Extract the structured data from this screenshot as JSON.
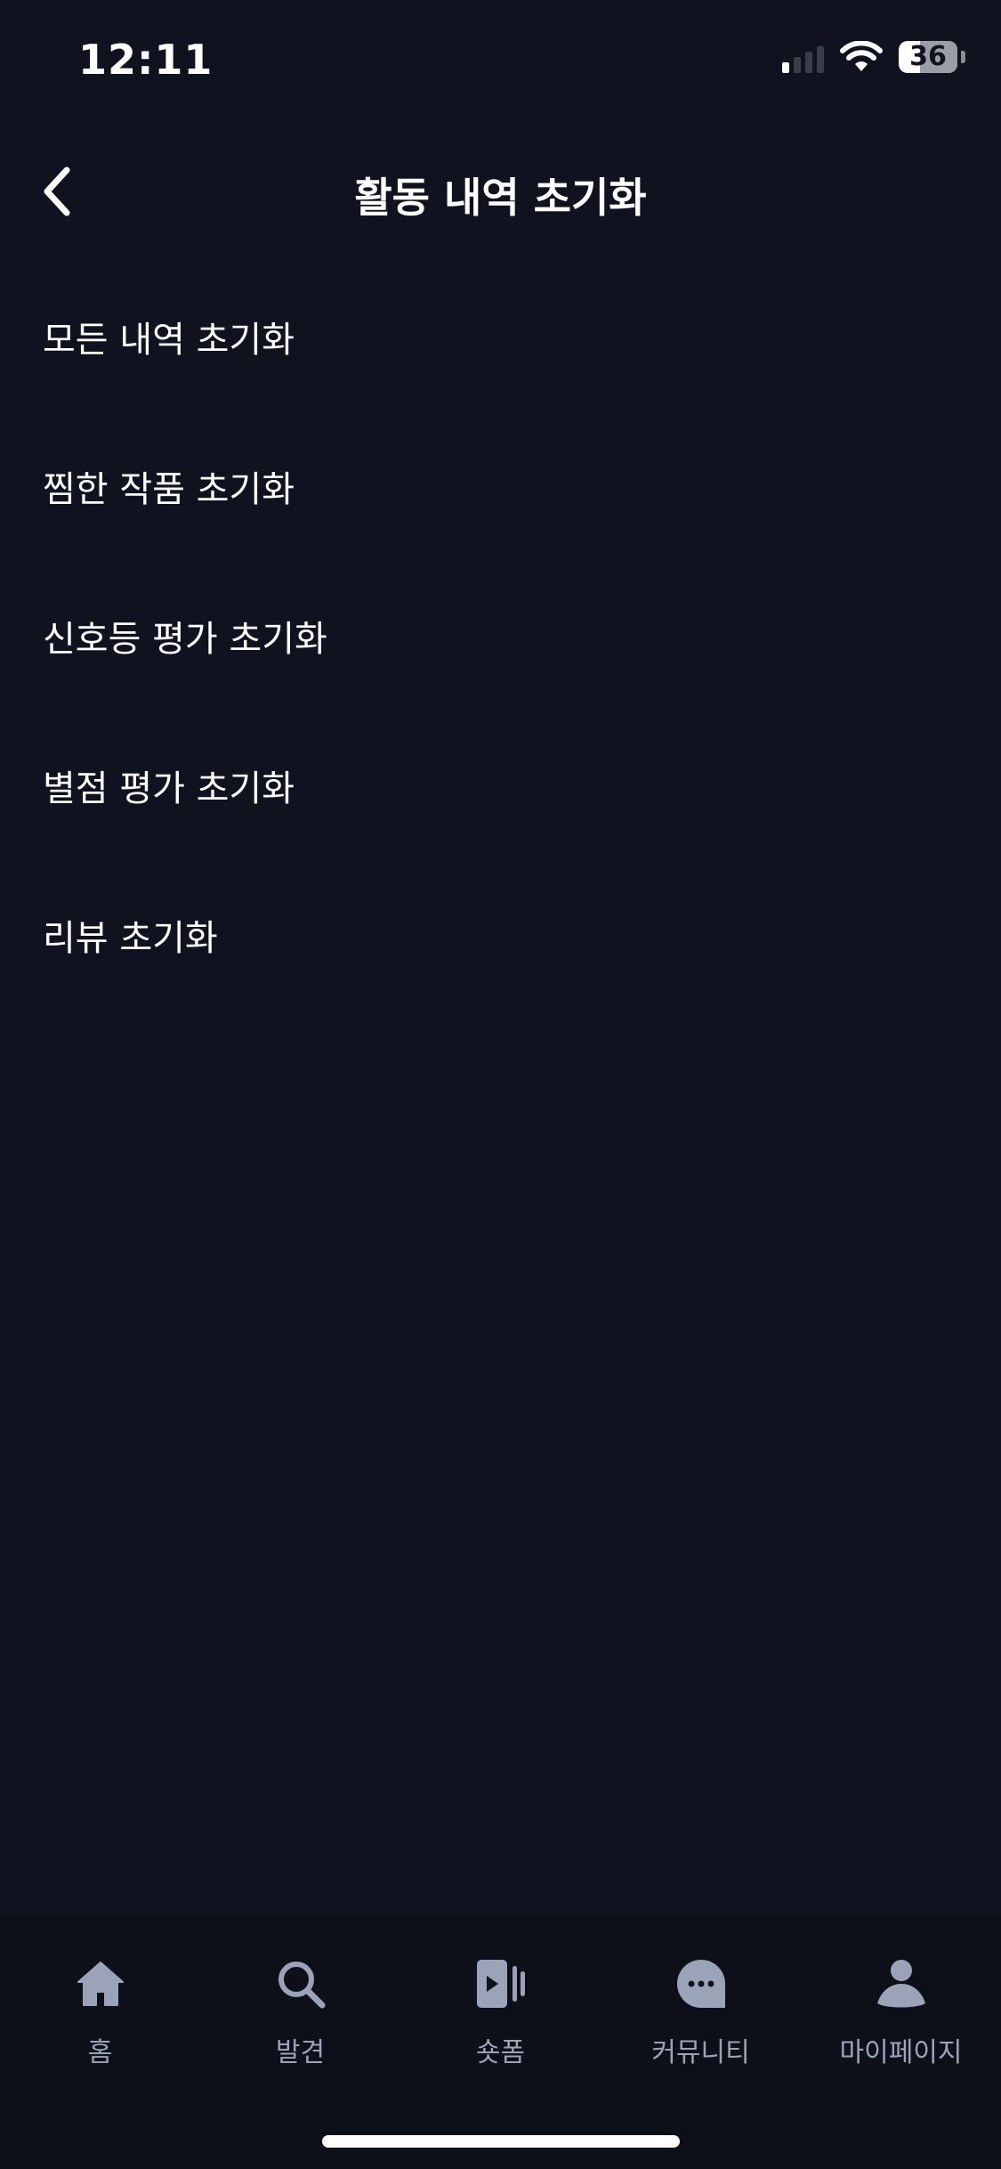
{
  "status_bar": {
    "time": "12:11",
    "battery": "36",
    "battery_level_percent": 36
  },
  "header": {
    "title": "활동 내역 초기화"
  },
  "menu": {
    "items": [
      {
        "label": "모든 내역 초기화"
      },
      {
        "label": "찜한 작품 초기화"
      },
      {
        "label": "신호등 평가 초기화"
      },
      {
        "label": "별점 평가 초기화"
      },
      {
        "label": "리뷰 초기화"
      }
    ]
  },
  "tab_bar": {
    "tabs": [
      {
        "label": "홈",
        "icon": "home-icon"
      },
      {
        "label": "발견",
        "icon": "search-icon"
      },
      {
        "label": "숏폼",
        "icon": "short-video-icon"
      },
      {
        "label": "커뮤니티",
        "icon": "chat-bubble-icon"
      },
      {
        "label": "마이페이지",
        "icon": "person-icon"
      }
    ],
    "icon_color": "#9aa3b8"
  },
  "colors": {
    "background": "#10121f",
    "tab_bar_background": "#0e1019",
    "text": "#ffffff",
    "muted": "#9aa3b8"
  }
}
